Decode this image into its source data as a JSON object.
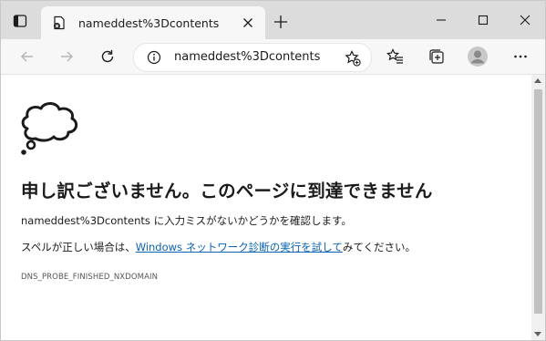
{
  "tab": {
    "title": "nameddest%3Dcontents"
  },
  "address": {
    "url": "nameddest%3Dcontents"
  },
  "content": {
    "headline": "申し訳ございません。このページに到達できません",
    "line1": "nameddest%3Dcontents に入力ミスがないかどうかを確認します。",
    "line2_prefix": "スペルが正しい場合は、",
    "line2_link": "Windows ネットワーク診断の実行を試して",
    "line2_suffix": "みてください。",
    "error_code": "DNS_PROBE_FINISHED_NXDOMAIN"
  },
  "icons": {
    "tab_actions": "tab-actions-icon",
    "favicon": "error-page-icon",
    "tab_close": "close-icon",
    "new_tab": "plus-icon",
    "minimize": "minimize-icon",
    "maximize": "maximize-icon",
    "window_close": "close-icon",
    "back": "back-arrow-icon",
    "forward": "forward-arrow-icon",
    "refresh": "refresh-icon",
    "site_info": "info-icon",
    "add_favorite": "star-plus-icon",
    "favorites": "favorites-icon",
    "collections": "collections-icon",
    "profile": "avatar-icon",
    "more": "more-icon",
    "thought": "thought-bubble-icon"
  },
  "colors": {
    "tabstrip": "#dcdcdc",
    "toolbar": "#f7f7f7",
    "link": "#0a64b4"
  }
}
